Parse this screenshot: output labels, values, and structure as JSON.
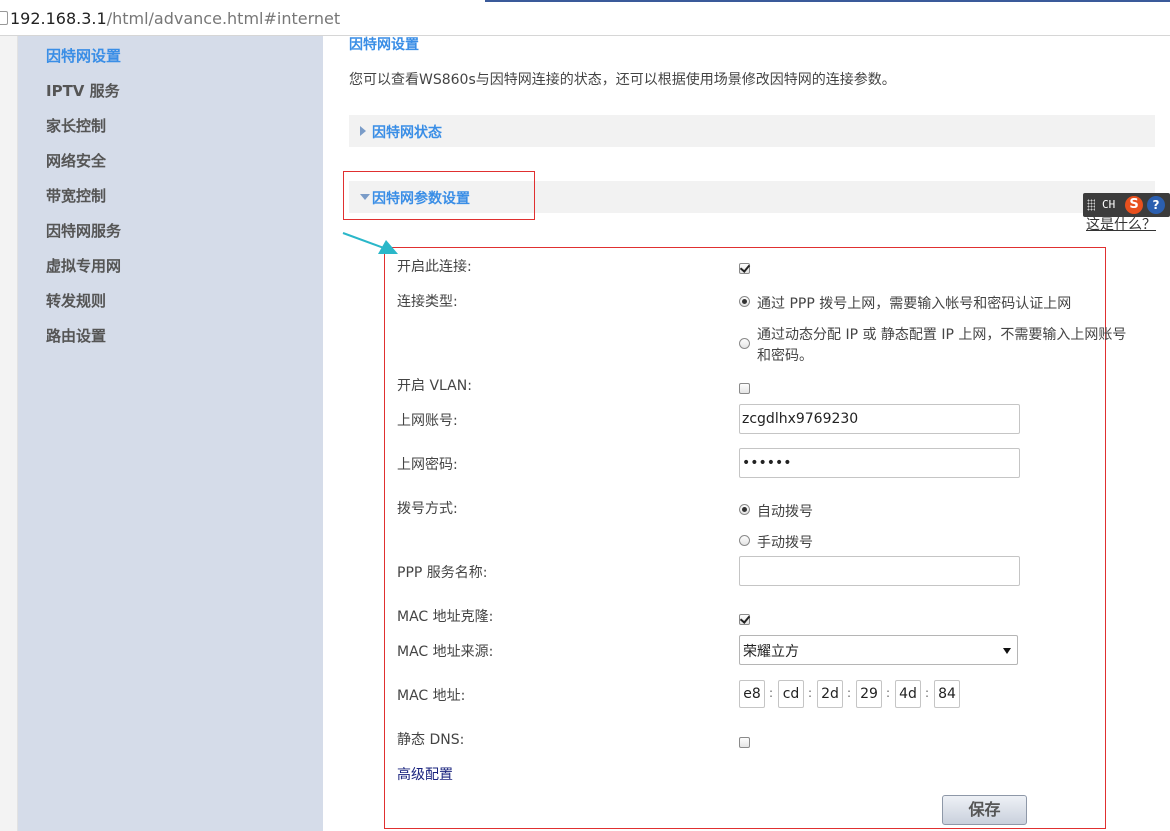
{
  "browser": {
    "url_host": "192.168.3.1",
    "url_path": "/html/advance.html#internet"
  },
  "sidebar": {
    "items": [
      {
        "label": "因特网设置",
        "active": true
      },
      {
        "label": "IPTV 服务",
        "active": false
      },
      {
        "label": "家长控制",
        "active": false
      },
      {
        "label": "网络安全",
        "active": false
      },
      {
        "label": "带宽控制",
        "active": false
      },
      {
        "label": "因特网服务",
        "active": false
      },
      {
        "label": "虚拟专用网",
        "active": false
      },
      {
        "label": "转发规则",
        "active": false
      },
      {
        "label": "路由设置",
        "active": false
      }
    ]
  },
  "main": {
    "title": "因特网设置",
    "description": "您可以查看WS860s与因特网连接的状态，还可以根据使用场景修改因特网的连接参数。",
    "section_status": "因特网状态",
    "section_params": "因特网参数设置",
    "help_link": "这是什么？"
  },
  "ime": {
    "lang": "CH",
    "logo": "S",
    "help": "?"
  },
  "form": {
    "enable_label": "开启此连接:",
    "enable_checked": true,
    "conn_type_label": "连接类型:",
    "conn_type_options": [
      "通过 PPP 拨号上网，需要输入帐号和密码认证上网",
      "通过动态分配 IP 或 静态配置 IP 上网，不需要输入上网账号",
      "和密码。"
    ],
    "conn_type_selected": 0,
    "vlan_label": "开启 VLAN:",
    "vlan_checked": false,
    "account_label": "上网账号:",
    "account_value": "zcgdlhx9769230",
    "password_label": "上网密码:",
    "password_value": "••••••",
    "dial_label": "拨号方式:",
    "dial_options": [
      "自动拨号",
      "手动拨号"
    ],
    "dial_selected": 0,
    "ppp_service_label": "PPP 服务名称:",
    "ppp_service_value": "",
    "mac_clone_label": "MAC 地址克隆:",
    "mac_clone_checked": true,
    "mac_source_label": "MAC 地址来源:",
    "mac_source_value": "荣耀立方",
    "mac_label": "MAC 地址:",
    "mac_octets": [
      "e8",
      "cd",
      "2d",
      "29",
      "4d",
      "84"
    ],
    "mac_separator": ":",
    "static_dns_label": "静态 DNS:",
    "static_dns_checked": false,
    "advanced_link": "高级配置",
    "save_label": "保存"
  },
  "colors": {
    "accent": "#3a8ee6",
    "sidebar_bg": "#d5dce9",
    "annotation_red": "#e03030",
    "annotation_cyan": "#2ab7c9"
  }
}
